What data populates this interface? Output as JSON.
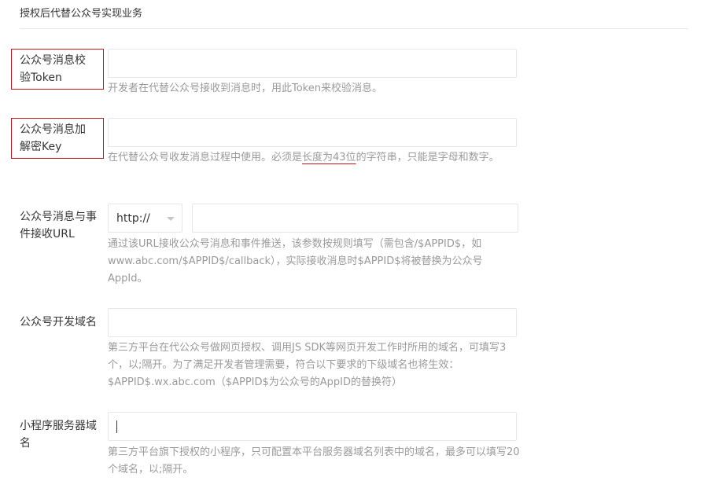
{
  "section": {
    "title": "授权后代替公众号实现业务"
  },
  "fields": {
    "token": {
      "label": "公众号消息校验Token",
      "value": "",
      "help": "开发者在代替公众号接收到消息时，用此Token来校验消息。"
    },
    "aeskey": {
      "label": "公众号消息加解密Key",
      "value": "",
      "help_prefix": "在代替公众号收发消息过程中使用。必须是",
      "help_highlight": "长度为43位",
      "help_suffix": "的字符串，只能是字母和数字。"
    },
    "event_url": {
      "label": "公众号消息与事件接收URL",
      "protocol_selected": "http://",
      "value": "",
      "help": "通过该URL接收公众号消息和事件推送，该参数按规则填写（需包含/$APPID$，如www.abc.com/$APPID$/callback），实际接收消息时$APPID$将被替换为公众号AppId。"
    },
    "dev_domain": {
      "label": "公众号开发域名",
      "value": "",
      "help": "第三方平台在代公众号做网页授权、调用JS SDK等网页开发工作时所用的域名，可填写3个，以;隔开。为了满足开发者管理需要，符合以下要求的下级域名也将生效：$APPID$.wx.abc.com（$APPID$为公众号的AppID的替换符）"
    },
    "miniprogram_domain": {
      "label": "小程序服务器域名",
      "value": "",
      "help": "第三方平台旗下授权的小程序，只可配置本平台服务器域名列表中的域名，最多可以填写20个域名，以;隔开。"
    }
  },
  "colors": {
    "highlight_box": "#c9151e",
    "help_text": "#9a9a9a",
    "border": "#e7e7eb"
  },
  "icons": {
    "protocol_dropdown": "chevron-down-icon"
  }
}
